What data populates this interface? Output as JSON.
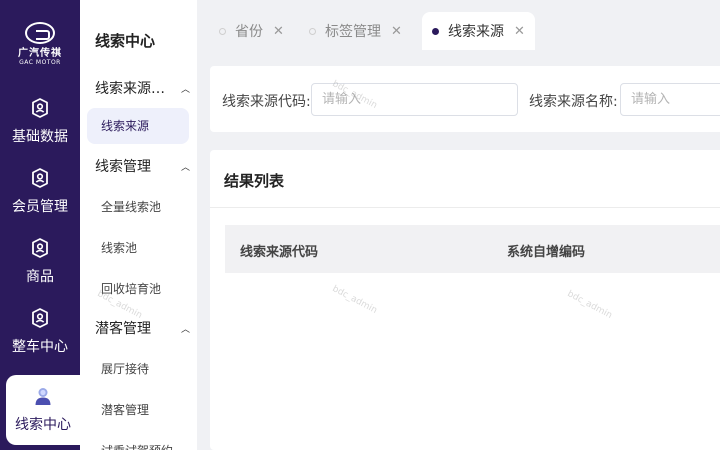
{
  "logo": {
    "cn": "广汽传祺",
    "en": "GAC MOTOR"
  },
  "rail": [
    {
      "label": "基础数据",
      "icon": "badge-user-icon"
    },
    {
      "label": "会员管理",
      "icon": "badge-user-icon"
    },
    {
      "label": "商品",
      "icon": "badge-user-icon"
    },
    {
      "label": "整车中心",
      "icon": "badge-user-icon"
    },
    {
      "label": "线索中心",
      "icon": "person-avatar-icon",
      "active": true
    }
  ],
  "menu": {
    "title": "线索中心",
    "groups": [
      {
        "label": "线索来源…",
        "children": [
          "线索来源"
        ]
      },
      {
        "label": "线索管理",
        "children": [
          "全量线索池",
          "线索池",
          "回收培育池"
        ]
      },
      {
        "label": "潜客管理",
        "children": [
          "展厅接待",
          "潜客管理",
          "试乘试驾预约"
        ]
      }
    ]
  },
  "tabs": [
    {
      "label": "省份",
      "active": false
    },
    {
      "label": "标签管理",
      "active": false
    },
    {
      "label": "线索来源",
      "active": true
    }
  ],
  "search": {
    "code_label": "线索来源代码:",
    "code_placeholder": "请输入",
    "name_label": "线索来源名称:",
    "name_placeholder": "请输入"
  },
  "results": {
    "title": "结果列表",
    "columns": [
      "线索来源代码",
      "系统自增编码"
    ]
  },
  "watermark": "bdc_admin",
  "colors": {
    "brand": "#2b1a5c",
    "active_bg": "#eef0fb"
  }
}
